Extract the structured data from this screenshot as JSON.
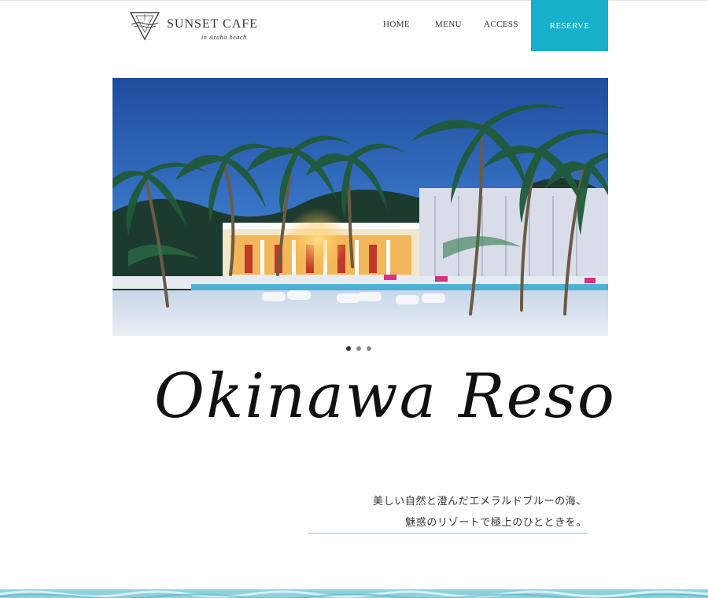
{
  "header": {
    "logo": {
      "title": "SUNSET CAFE",
      "subtitle": "in Araha beach",
      "icon": "triangle-emblem-icon"
    },
    "nav": [
      {
        "label": "HOME"
      },
      {
        "label": "MENU"
      },
      {
        "label": "ACCESS"
      }
    ],
    "reserve_label": "RESERVE",
    "accent_color": "#17afc9"
  },
  "hero": {
    "image": "beach-resort-at-dusk",
    "slide_count": 3,
    "active_slide": 1
  },
  "headline": "Okinawa Resort",
  "tagline": {
    "line1": "美しい自然と澄んだエメラルドブルーの海、",
    "line2": "魅惑のリゾートで極上のひとときを。"
  }
}
